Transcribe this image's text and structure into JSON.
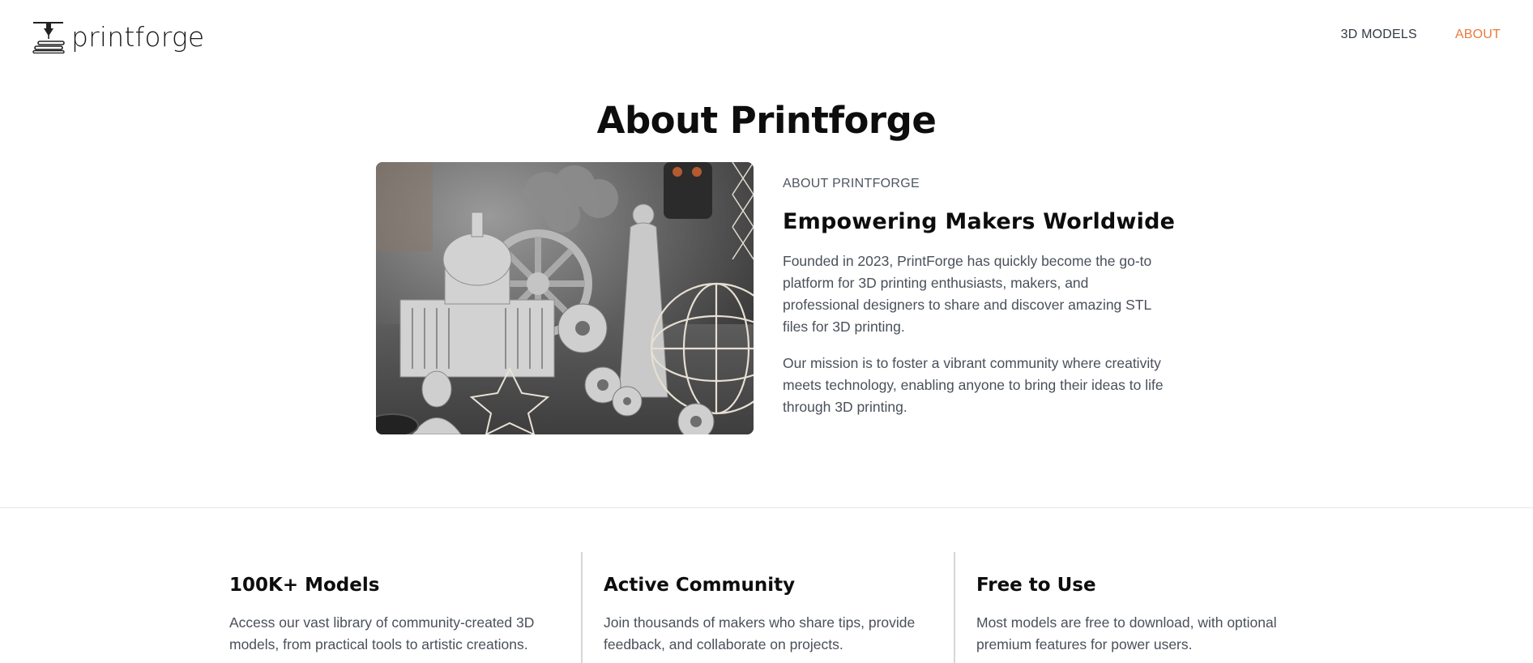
{
  "brand": {
    "name": "printforge",
    "logo_icon": "printer-nozzle-icon"
  },
  "nav": {
    "items": [
      {
        "label": "3D MODELS",
        "active": false
      },
      {
        "label": "ABOUT",
        "active": true
      }
    ],
    "active_color": "#ea7a3c"
  },
  "hero": {
    "title": "About Printforge",
    "image_icon": "3d-printed-models-photo"
  },
  "about": {
    "eyebrow": "ABOUT PRINTFORGE",
    "heading": "Empowering Makers Worldwide",
    "paragraphs": [
      "Founded in 2023, PrintForge has quickly become the go-to platform for 3D printing enthusiasts, makers, and professional designers to share and discover amazing STL files for 3D printing.",
      "Our mission is to foster a vibrant community where creativity meets technology, enabling anyone to bring their ideas to life through 3D printing."
    ]
  },
  "features": [
    {
      "title": "100K+ Models",
      "description": "Access our vast library of community-created 3D models, from practical tools to artistic creations."
    },
    {
      "title": "Active Community",
      "description": "Join thousands of makers who share tips, provide feedback, and collaborate on projects."
    },
    {
      "title": "Free to Use",
      "description": "Most models are free to download, with optional premium features for power users."
    }
  ]
}
